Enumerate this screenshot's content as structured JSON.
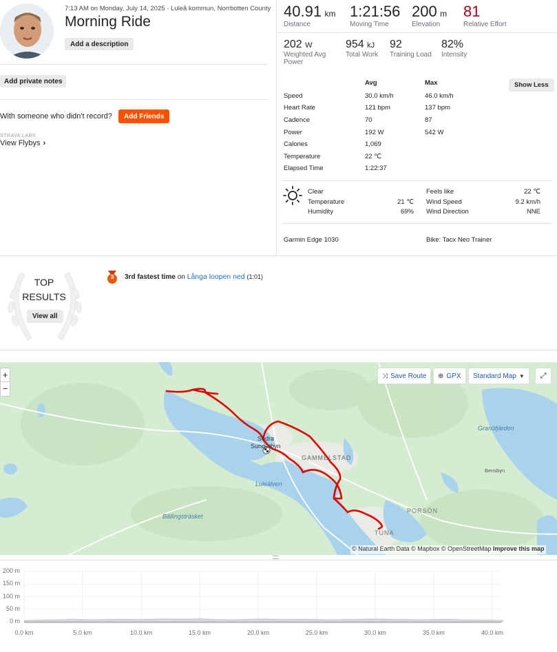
{
  "activity": {
    "date_location": "7:13 AM on Monday, July 14, 2025 · Luleå kommun, Norrbotten County",
    "title": "Morning Ride",
    "add_description": "Add a description",
    "add_private_notes": "Add private notes",
    "with_someone": "With someone who didn't record?",
    "add_friends": "Add Friends",
    "labs_label": "STRAVA LABS",
    "view_flybys": "View Flybys"
  },
  "primary_stats": [
    {
      "value": "40.91",
      "unit": "km",
      "label": "Distance"
    },
    {
      "value": "1:21:56",
      "unit": "",
      "label": "Moving Time"
    },
    {
      "value": "200",
      "unit": "m",
      "label": "Elevation"
    },
    {
      "value": "81",
      "unit": "",
      "label": "Relative Effort"
    }
  ],
  "secondary_stats": [
    {
      "value": "202",
      "unit": "W",
      "label": "Weighted Avg Power"
    },
    {
      "value": "954",
      "unit": "kJ",
      "label": "Total Work"
    },
    {
      "value": "92",
      "unit": "",
      "label": "Training Load"
    },
    {
      "value": "82%",
      "unit": "",
      "label": "Intensity"
    }
  ],
  "details_table": {
    "headers": [
      "Avg",
      "Max"
    ],
    "show_less": "Show Less",
    "rows": [
      {
        "label": "Speed",
        "avg": "30.0 km/h",
        "max": "46.0 km/h"
      },
      {
        "label": "Heart Rate",
        "avg": "121 bpm",
        "max": "137 bpm"
      },
      {
        "label": "Cadence",
        "avg": "70",
        "max": "87"
      },
      {
        "label": "Power",
        "avg": "192 W",
        "max": "542 W"
      },
      {
        "label": "Calories",
        "avg": "1,069",
        "max": ""
      },
      {
        "label": "Temperature",
        "avg": "22 ℃",
        "max": ""
      },
      {
        "label": "Elapsed Time",
        "avg": "1:22:37",
        "max": ""
      }
    ]
  },
  "weather": {
    "condition": "Clear",
    "temperature_label": "Temperature",
    "temperature": "21 ℃",
    "humidity_label": "Humidity",
    "humidity": "69%",
    "feels_like_label": "Feels like",
    "feels_like": "22 ℃",
    "wind_speed_label": "Wind Speed",
    "wind_speed": "9.2 km/h",
    "wind_direction_label": "Wind Direction",
    "wind_direction": "NNE"
  },
  "device": "Garmin Edge 1030",
  "bike": "Bike: Tacx Neo Trainer",
  "top_results": {
    "title_line1": "TOP",
    "title_line2": "RESULTS",
    "view_all": "View all",
    "medal_rank": "3",
    "achievement_bold": "3rd fastest time",
    "achievement_on": "on",
    "segment_name": "Långa loopen ned",
    "segment_time": "(1:01)"
  },
  "map": {
    "zoom_in": "+",
    "zoom_out": "−",
    "save_route": "Save Route",
    "gpx": "GPX",
    "map_style": "Standard Map",
    "attribution": "© Natural Earth Data © Mapbox © OpenStreetMap",
    "improve": "Improve this map",
    "labels": [
      "Södra",
      "Sunderbyn",
      "GAMMELSTAD",
      "Luleälven",
      "Bällingsträsket",
      "Granöfjärden",
      "Bensbyn",
      "PORSÖN",
      "TUNA"
    ],
    "colors": {
      "land": "#d6ecd2",
      "water": "#a9d2ec",
      "route": "#e00000"
    }
  },
  "elevation_chart": {
    "y_ticks": [
      "200 m",
      "150 m",
      "100 m",
      "50 m",
      "0 m"
    ],
    "x_ticks": [
      "0.0 km",
      "5.0 km",
      "10.0 km",
      "15.0 km",
      "20.0 km",
      "25.0 km",
      "30.0 km",
      "35.0 km",
      "40.0 km"
    ]
  },
  "chart_data": {
    "type": "area",
    "xlabel": "",
    "ylabel": "",
    "ylim": [
      0,
      200
    ],
    "xlim": [
      0,
      40.91
    ],
    "x": [
      0,
      2,
      4,
      6,
      8,
      10,
      12,
      14,
      15,
      16,
      18,
      20,
      22,
      24,
      26,
      28,
      30,
      32,
      34,
      36,
      38,
      40,
      40.91
    ],
    "y": [
      5,
      7,
      9,
      8,
      10,
      9,
      11,
      10,
      12,
      9,
      8,
      11,
      9,
      10,
      8,
      9,
      11,
      9,
      8,
      10,
      7,
      6,
      5
    ]
  }
}
